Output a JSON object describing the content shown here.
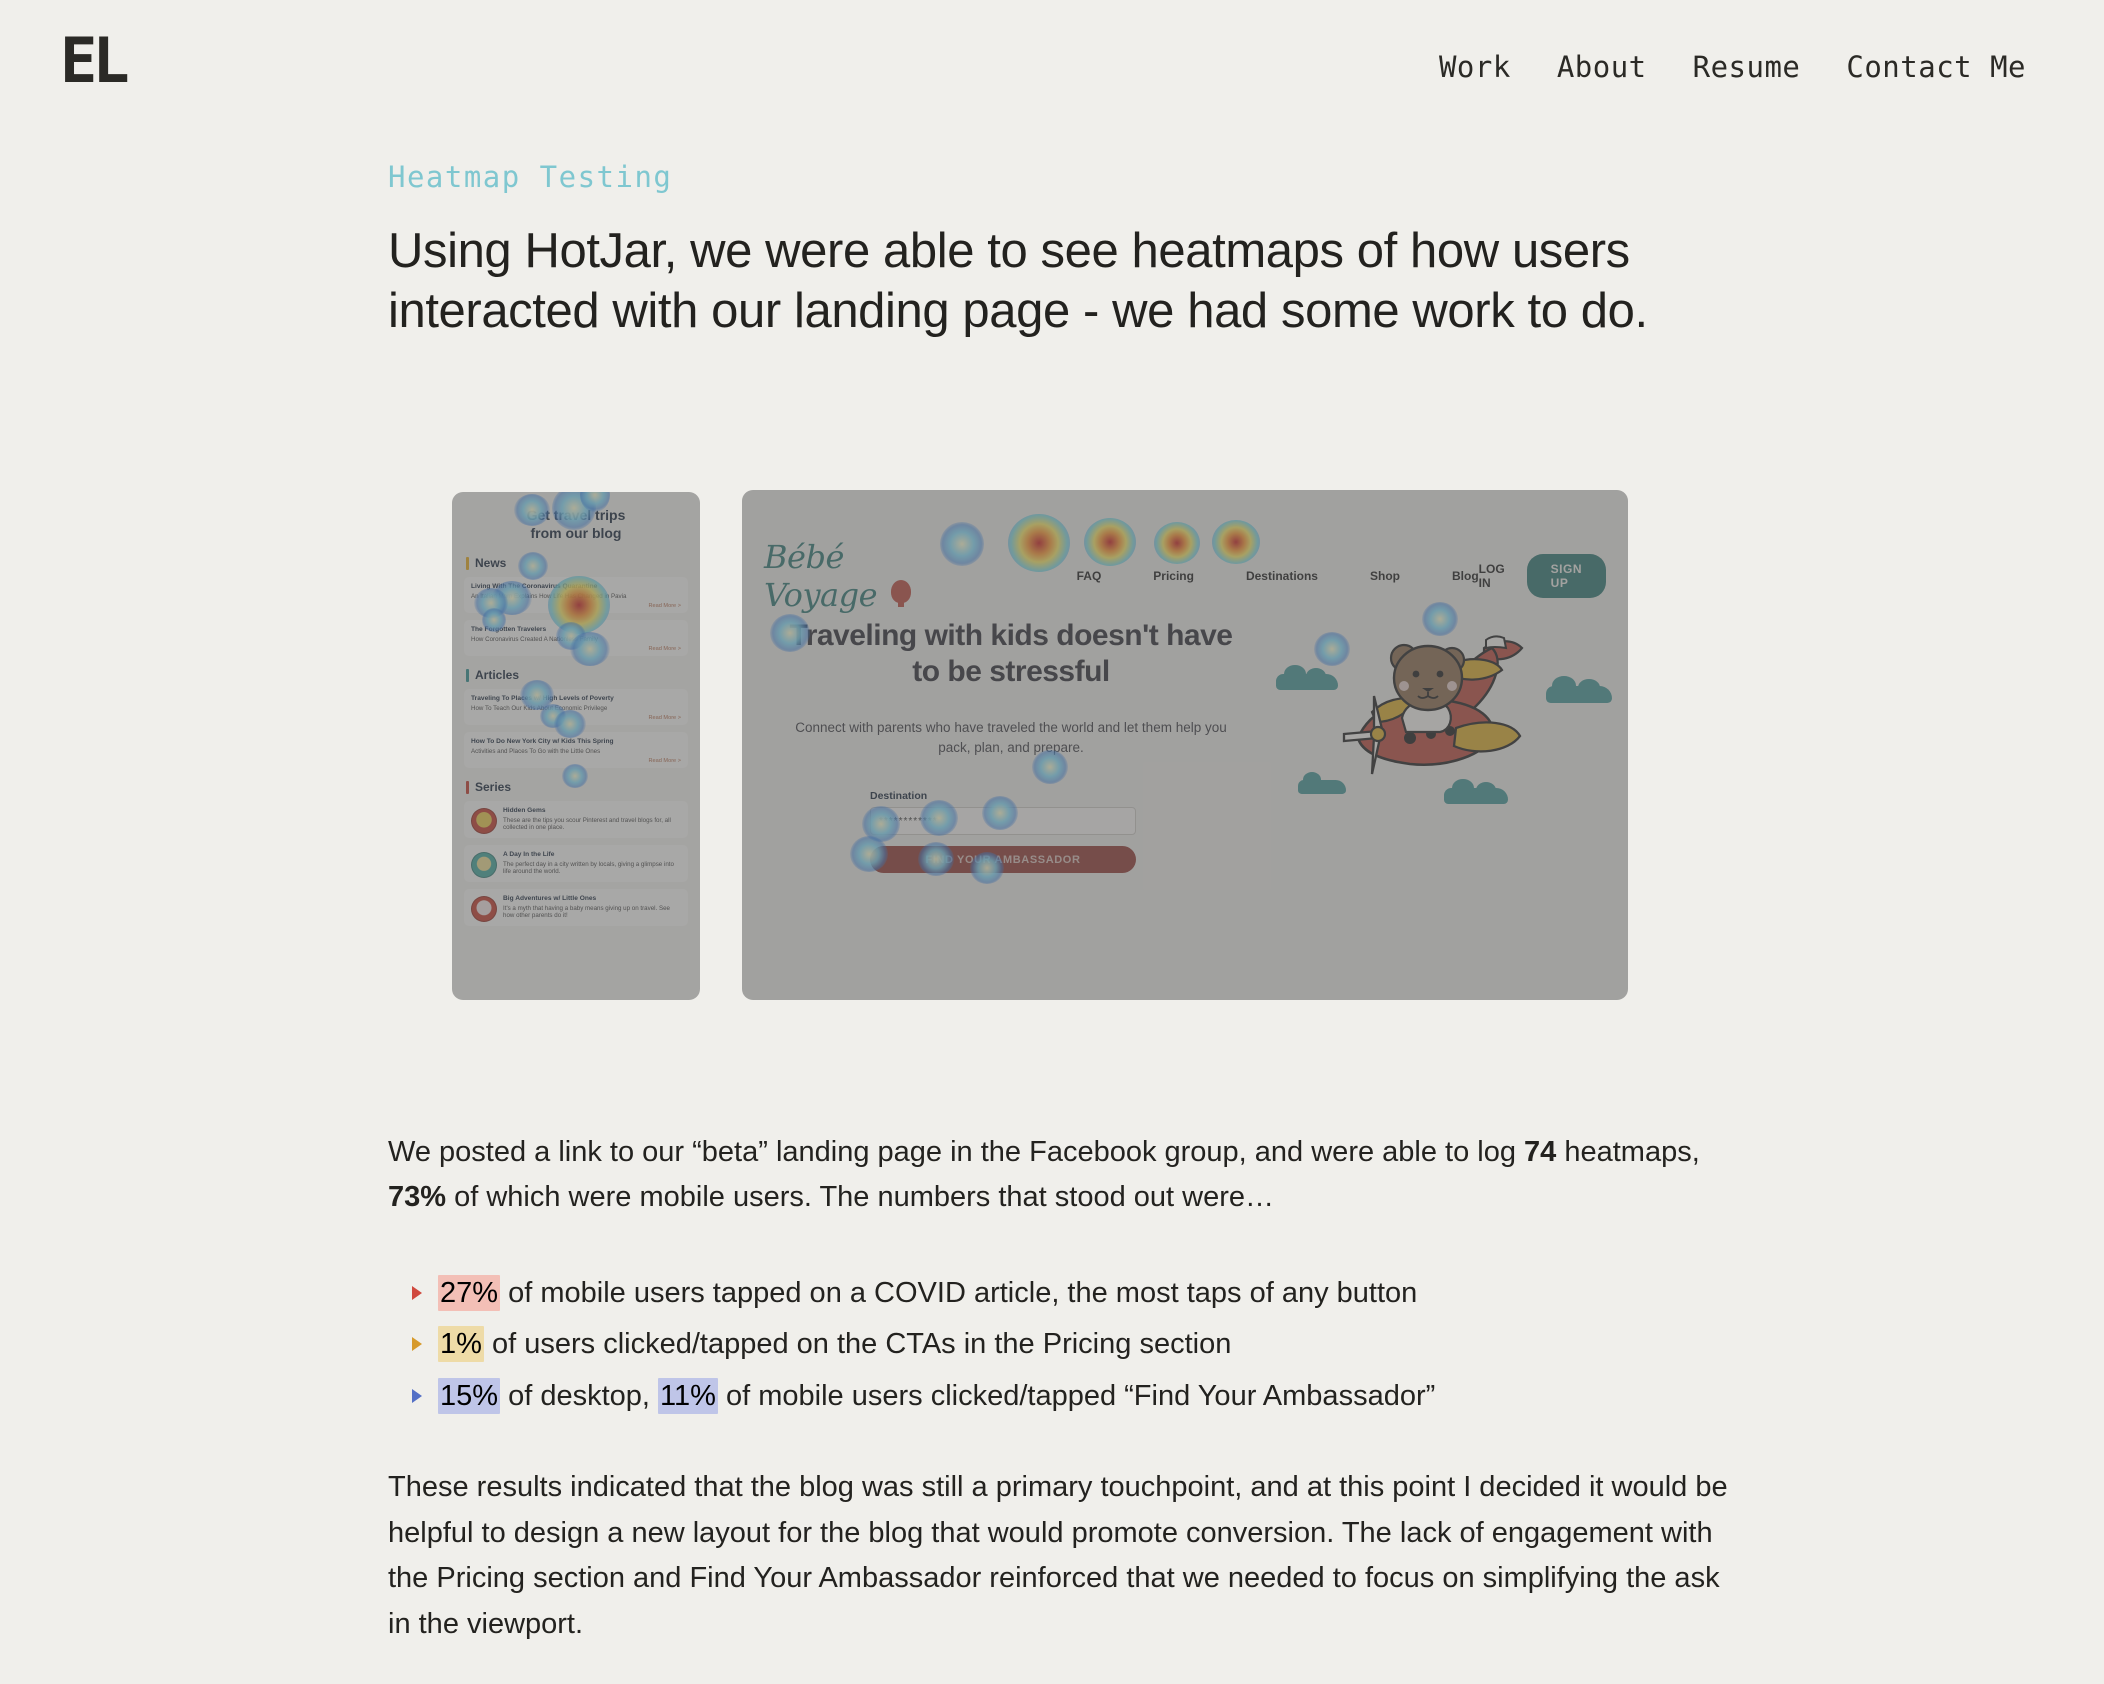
{
  "header": {
    "logo": "EL",
    "nav": [
      {
        "label": "Work"
      },
      {
        "label": "About"
      },
      {
        "label": "Resume"
      },
      {
        "label": "Contact Me"
      }
    ]
  },
  "section": {
    "eyebrow": "Heatmap Testing",
    "headline": "Using HotJar, we were able to see heatmaps of how users interacted with our landing page - we had some work to do."
  },
  "figure": {
    "phone": {
      "hero_line1": "Get travel trips",
      "hero_line2": "from our blog",
      "sections": [
        {
          "title": "News",
          "cards": [
            {
              "title": "Living With The Coronavirus Quarantine",
              "sub": "An Italian Mom Explains How Life Has Changed in Pavia",
              "more": "Read More >"
            },
            {
              "title": "The Forgotten Travelers",
              "sub": "How Coronavirus Created A Nationless Family",
              "more": "Read More >"
            }
          ]
        },
        {
          "title": "Articles",
          "cards": [
            {
              "title": "Traveling To Places w/ High Levels of Poverty",
              "sub": "How To Teach Our Kids About Economic Privilege",
              "more": "Read More >"
            },
            {
              "title": "How To Do New York City w/ Kids This Spring",
              "sub": "Activities and Places To Go with the Little Ones",
              "more": "Read More >"
            }
          ]
        },
        {
          "title": "Series",
          "series": [
            {
              "title": "Hidden Gems",
              "sub": "These are the tips you scour Pinterest and travel blogs for, all collected in one place."
            },
            {
              "title": "A Day In the Life",
              "sub": "The perfect day in a city written by locals, giving a glimpse into life around the world."
            },
            {
              "title": "Big Adventures w/ Little Ones",
              "sub": "It's a myth that having a baby means giving up on travel. See how other parents do it!"
            }
          ]
        }
      ]
    },
    "desktop": {
      "brand": "Bébé Voyage",
      "nav_links": [
        "FAQ",
        "Pricing",
        "Destinations",
        "Shop",
        "Blog"
      ],
      "login": "LOG IN",
      "signup": "SIGN UP",
      "hero_title": "Traveling with kids doesn't have to be stressful",
      "hero_sub": "Connect with parents who have traveled the world and let them help you pack, plan, and prepare.",
      "form_label": "Destination",
      "form_value": "************",
      "form_button": "FIND YOUR AMBASSADOR"
    }
  },
  "body": {
    "para1_a": "We posted a link to our “beta” landing page in the Facebook group, and were able to log ",
    "para1_b": "74",
    "para1_c": " heatmaps, ",
    "para1_d": "73%",
    "para1_e": " of which were mobile users.  The numbers that stood out were…",
    "bullets": [
      {
        "highlight": "27%",
        "rest": " of mobile users tapped on a COVID article, the most taps of any  button",
        "color": "red"
      },
      {
        "highlight": "1%",
        "rest": " of users clicked/tapped on the CTAs in the Pricing section",
        "color": "amber"
      },
      {
        "highlight": "15%",
        "mid": " of desktop, ",
        "highlight2": "11%",
        "rest": " of mobile users clicked/tapped “Find Your Ambassador”",
        "color": "blue"
      }
    ],
    "closing": "These results indicated that the blog was still a primary touchpoint, and at this point I decided it would be helpful to design a new layout for the blog that would promote conversion.  The lack of engagement with the Pricing section and Find Your Ambassador reinforced that we needed to focus on simplifying the ask in the viewport."
  },
  "colors": {
    "background": "#F0EFEB",
    "accent_teal": "#7FC7D0",
    "text": "#23221F",
    "highlight_red": "#F3BFB6",
    "highlight_amber": "#EEDBA7",
    "highlight_blue": "#BFC5E8"
  }
}
